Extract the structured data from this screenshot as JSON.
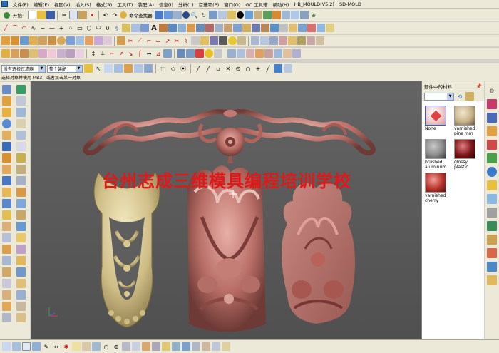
{
  "menu": [
    "文件(F)",
    "编辑(E)",
    "视图(V)",
    "插入(S)",
    "格式(R)",
    "工具(T)",
    "装配(A)",
    "信息(I)",
    "分析(L)",
    "首选项(P)",
    "窗口(O)",
    "GC 工具箱",
    "帮助(H)",
    "HB_MOULD(V5.2)",
    "SD-MOLD"
  ],
  "toolbar": {
    "start_label": "开始·",
    "command_finder_label": "命令查找器"
  },
  "filter": {
    "selection_filter": "没有选择过滤器",
    "assembly_scope": "整个装配"
  },
  "cue": "选择对象并使用 MB3，或者双击某一对象",
  "watermark": "台州志成三维模具编程培训学校",
  "panel": {
    "title": "部件中的材料",
    "materials": [
      {
        "name": "None",
        "color": "#f2d6d6"
      },
      {
        "name": "varnished pine mm",
        "color": "#c8b28a"
      },
      {
        "name": "brushed aluminum",
        "color": "#8a8a8a"
      },
      {
        "name": "glossy plastic",
        "color": "#7a1518"
      },
      {
        "name": "varnished cherry",
        "color": "#b8322a"
      }
    ]
  },
  "colors": {
    "viewport_bg": "#5a5a5a",
    "watermark": "#e01818",
    "gold": "#d2c28c",
    "bronze_pink": "#c07a72"
  }
}
